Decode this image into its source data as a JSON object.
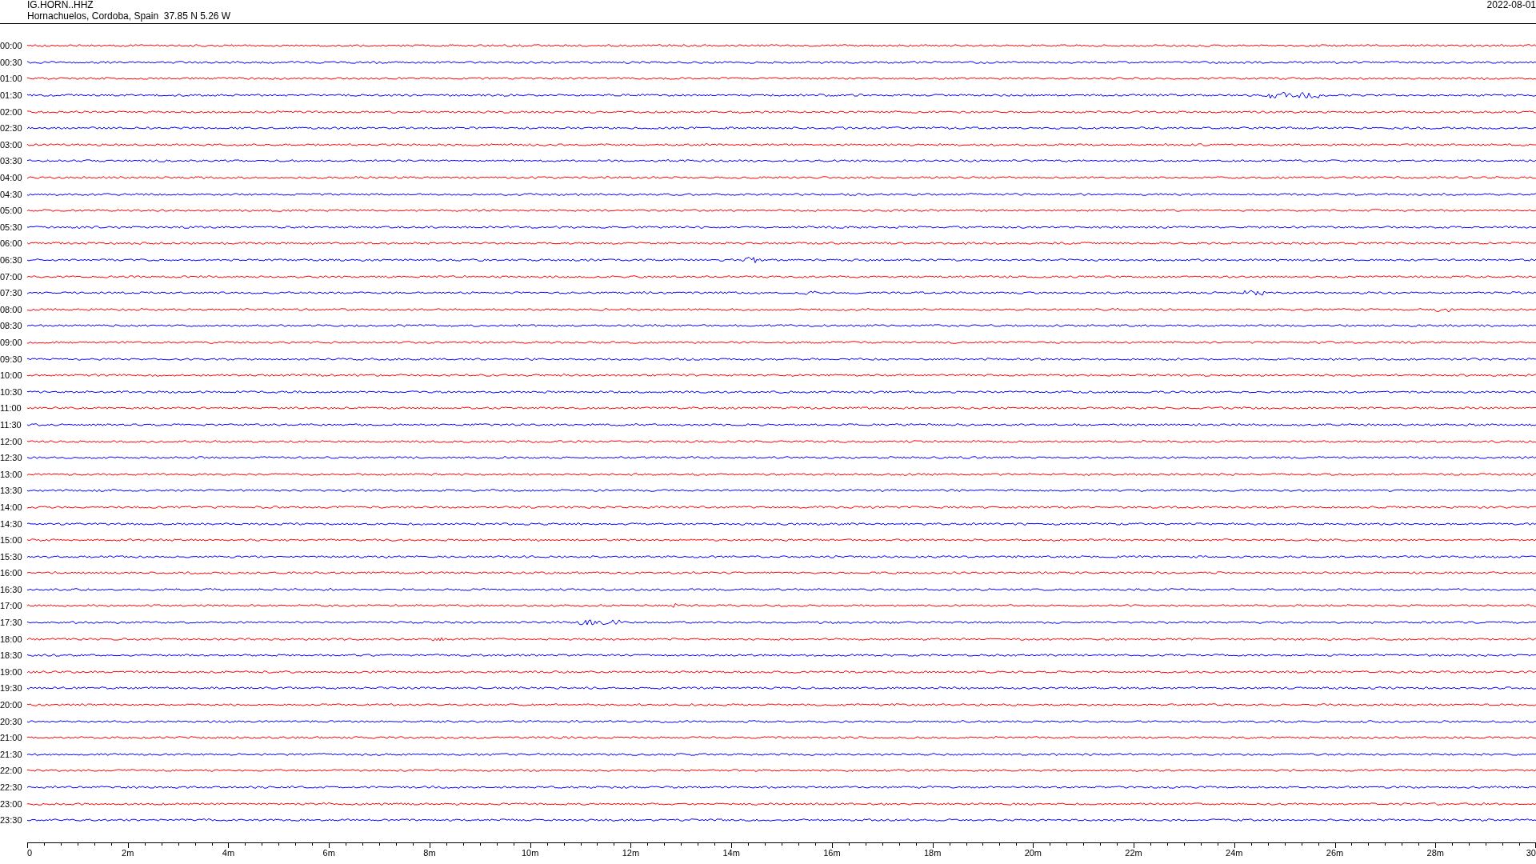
{
  "header": {
    "station": "IG.HORN..HHZ",
    "location": "Hornachuelos, Cordoba, Spain  37.85 N 5.26 W",
    "date": "2022-08-01"
  },
  "rows": [
    {
      "time": "00:00",
      "color": "#ff0000"
    },
    {
      "time": "00:30",
      "color": "#0000ff"
    },
    {
      "time": "01:00",
      "color": "#ff0000"
    },
    {
      "time": "01:30",
      "color": "#0000ff"
    },
    {
      "time": "02:00",
      "color": "#ff0000"
    },
    {
      "time": "02:30",
      "color": "#0000ff"
    },
    {
      "time": "03:00",
      "color": "#ff0000"
    },
    {
      "time": "03:30",
      "color": "#0000ff"
    },
    {
      "time": "04:00",
      "color": "#ff0000"
    },
    {
      "time": "04:30",
      "color": "#0000ff"
    },
    {
      "time": "05:00",
      "color": "#ff0000"
    },
    {
      "time": "05:30",
      "color": "#0000ff"
    },
    {
      "time": "06:00",
      "color": "#ff0000"
    },
    {
      "time": "06:30",
      "color": "#0000ff"
    },
    {
      "time": "07:00",
      "color": "#ff0000"
    },
    {
      "time": "07:30",
      "color": "#0000ff"
    },
    {
      "time": "08:00",
      "color": "#ff0000"
    },
    {
      "time": "08:30",
      "color": "#0000ff"
    },
    {
      "time": "09:00",
      "color": "#ff0000"
    },
    {
      "time": "09:30",
      "color": "#0000ff"
    },
    {
      "time": "10:00",
      "color": "#ff0000"
    },
    {
      "time": "10:30",
      "color": "#0000ff"
    },
    {
      "time": "11:00",
      "color": "#ff0000"
    },
    {
      "time": "11:30",
      "color": "#0000ff"
    },
    {
      "time": "12:00",
      "color": "#ff0000"
    },
    {
      "time": "12:30",
      "color": "#0000ff"
    },
    {
      "time": "13:00",
      "color": "#ff0000"
    },
    {
      "time": "13:30",
      "color": "#0000ff"
    },
    {
      "time": "14:00",
      "color": "#ff0000"
    },
    {
      "time": "14:30",
      "color": "#0000ff"
    },
    {
      "time": "15:00",
      "color": "#ff0000"
    },
    {
      "time": "15:30",
      "color": "#0000ff"
    },
    {
      "time": "16:00",
      "color": "#ff0000"
    },
    {
      "time": "16:30",
      "color": "#0000ff"
    },
    {
      "time": "17:00",
      "color": "#ff0000"
    },
    {
      "time": "17:30",
      "color": "#0000ff"
    },
    {
      "time": "18:00",
      "color": "#ff0000"
    },
    {
      "time": "18:30",
      "color": "#0000ff"
    },
    {
      "time": "19:00",
      "color": "#ff0000"
    },
    {
      "time": "19:30",
      "color": "#0000ff"
    },
    {
      "time": "20:00",
      "color": "#ff0000"
    },
    {
      "time": "20:30",
      "color": "#0000ff"
    },
    {
      "time": "21:00",
      "color": "#ff0000"
    },
    {
      "time": "21:30",
      "color": "#0000ff"
    },
    {
      "time": "22:00",
      "color": "#ff0000"
    },
    {
      "time": "22:30",
      "color": "#0000ff"
    },
    {
      "time": "23:00",
      "color": "#ff0000"
    },
    {
      "time": "23:30",
      "color": "#0000ff"
    }
  ],
  "axis": {
    "ticks": [
      "0",
      "2m",
      "4m",
      "6m",
      "8m",
      "10m",
      "12m",
      "14m",
      "16m",
      "18m",
      "20m",
      "22m",
      "24m",
      "26m",
      "28m",
      "30"
    ]
  }
}
